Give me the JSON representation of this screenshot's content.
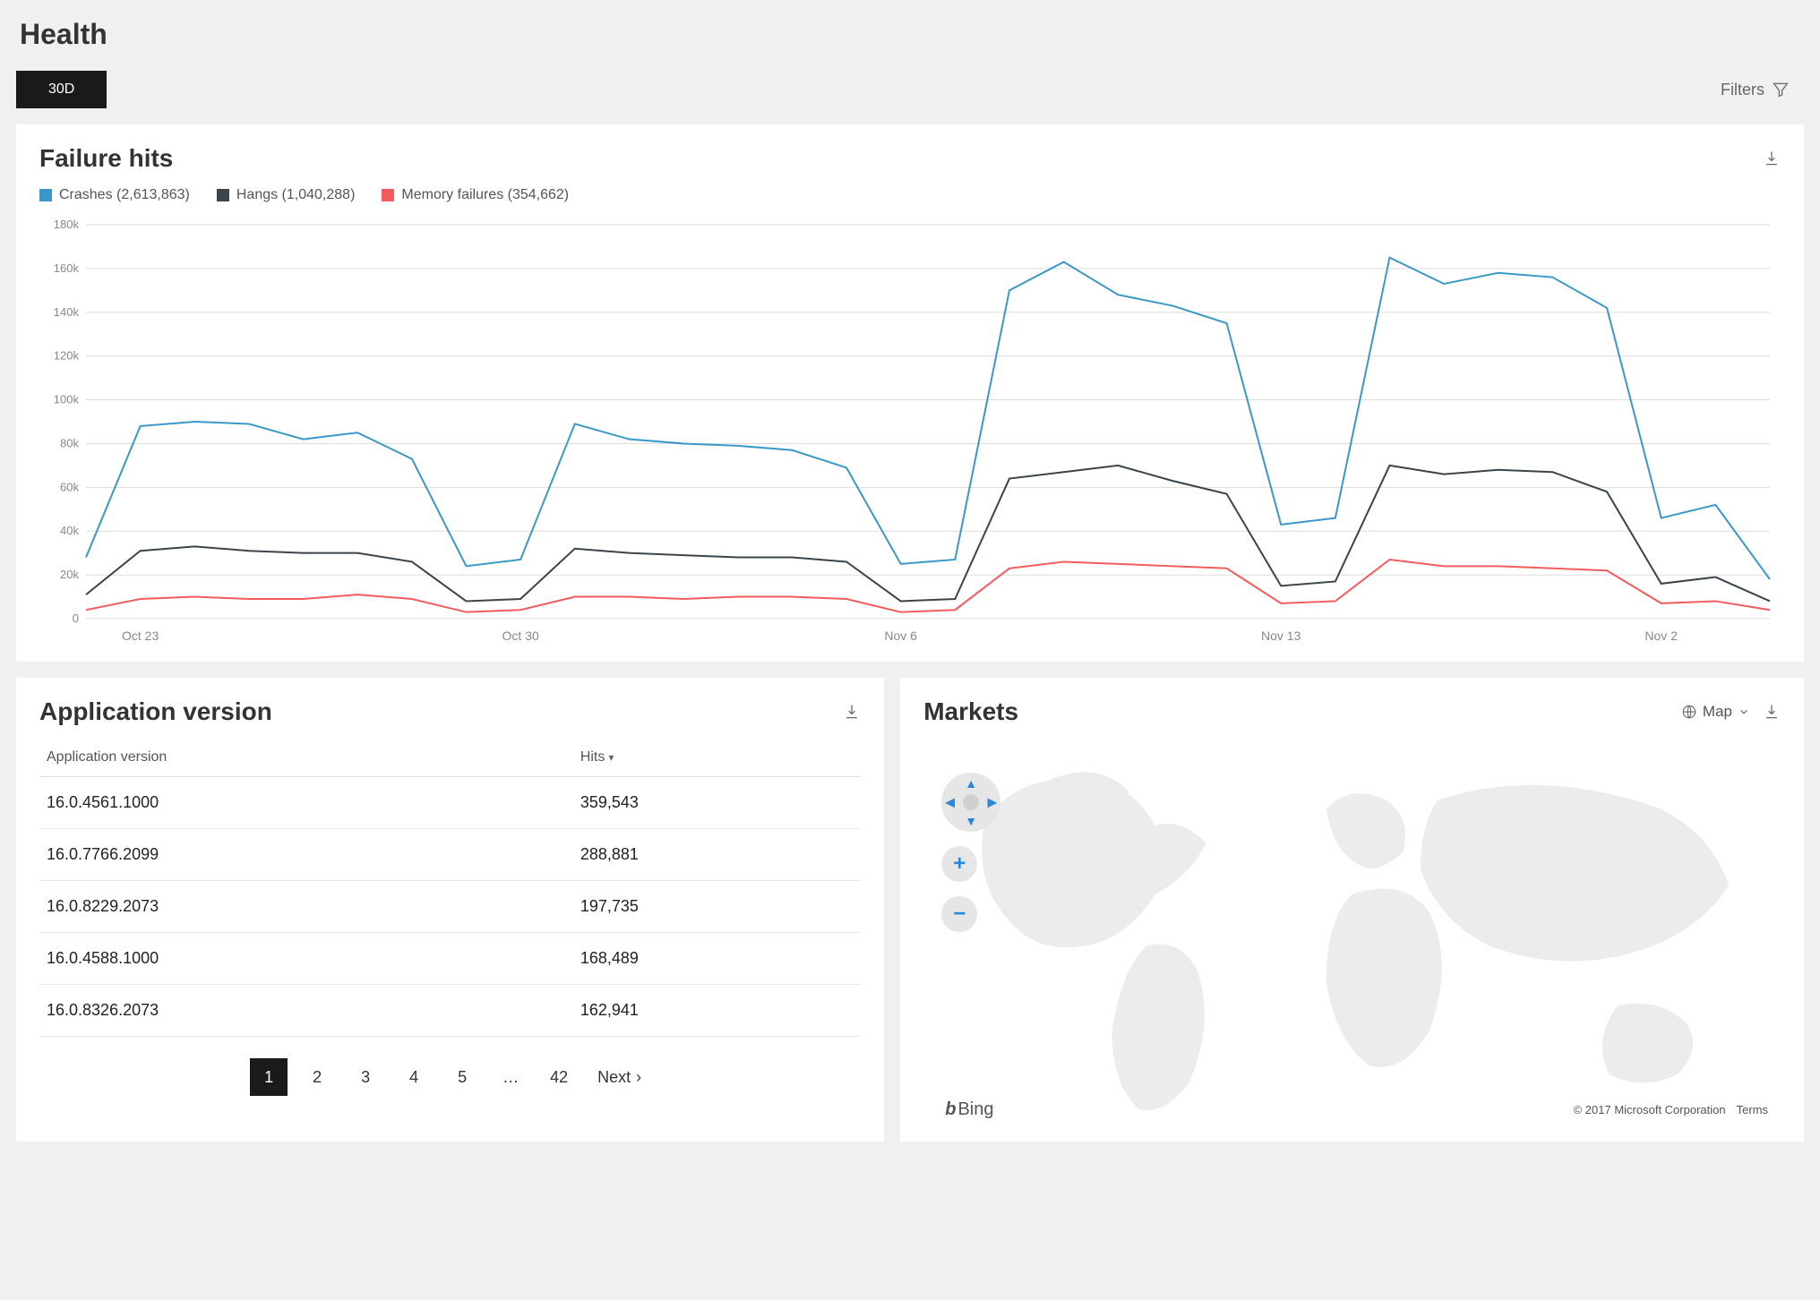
{
  "page": {
    "title": "Health",
    "range_button": "30D",
    "filters_label": "Filters"
  },
  "failure_hits": {
    "title": "Failure hits",
    "legend": [
      {
        "label": "Crashes (2,613,863)",
        "color": "#3a98c7"
      },
      {
        "label": "Hangs (1,040,288)",
        "color": "#3b444b"
      },
      {
        "label": "Memory failures (354,662)",
        "color": "#f25c5c"
      }
    ]
  },
  "chart_data": {
    "type": "line",
    "x": [
      "Oct 22",
      "Oct 23",
      "Oct 24",
      "Oct 25",
      "Oct 26",
      "Oct 27",
      "Oct 28",
      "Oct 29",
      "Oct 30",
      "Oct 31",
      "Nov 1",
      "Nov 2",
      "Nov 3",
      "Nov 4",
      "Nov 5",
      "Nov 6",
      "Nov 7",
      "Nov 8",
      "Nov 9",
      "Nov 10",
      "Nov 11",
      "Nov 12",
      "Nov 13",
      "Nov 14",
      "Nov 15",
      "Nov 16",
      "Nov 17",
      "Nov 18",
      "Nov 19",
      "Nov 20"
    ],
    "x_tick_labels": [
      "Oct 23",
      "Oct 30",
      "Nov 6",
      "Nov 13",
      "Nov 2"
    ],
    "x_tick_indices": [
      1,
      8,
      15,
      22,
      29
    ],
    "y_ticks": [
      0,
      20000,
      40000,
      60000,
      80000,
      100000,
      120000,
      140000,
      160000,
      180000
    ],
    "y_tick_labels": [
      "0",
      "20k",
      "40k",
      "60k",
      "80k",
      "100k",
      "120k",
      "140k",
      "160k",
      "180k"
    ],
    "ylim": [
      0,
      180000
    ],
    "series": [
      {
        "name": "Crashes",
        "color": "#3a98c7",
        "values": [
          28000,
          88000,
          90000,
          89000,
          82000,
          85000,
          73000,
          24000,
          27000,
          89000,
          82000,
          80000,
          79000,
          77000,
          69000,
          25000,
          27000,
          150000,
          163000,
          148000,
          143000,
          135000,
          43000,
          46000,
          165000,
          153000,
          158000,
          156000,
          142000,
          46000,
          52000,
          18000
        ]
      },
      {
        "name": "Hangs",
        "color": "#3b444b",
        "values": [
          11000,
          31000,
          33000,
          31000,
          30000,
          30000,
          26000,
          8000,
          9000,
          32000,
          30000,
          29000,
          28000,
          28000,
          26000,
          8000,
          9000,
          64000,
          67000,
          70000,
          63000,
          57000,
          15000,
          17000,
          70000,
          66000,
          68000,
          67000,
          58000,
          16000,
          19000,
          8000
        ]
      },
      {
        "name": "Memory failures",
        "color": "#f25c5c",
        "values": [
          4000,
          9000,
          10000,
          9000,
          9000,
          11000,
          9000,
          3000,
          4000,
          10000,
          10000,
          9000,
          10000,
          10000,
          9000,
          3000,
          4000,
          23000,
          26000,
          25000,
          24000,
          23000,
          7000,
          8000,
          27000,
          24000,
          24000,
          23000,
          22000,
          7000,
          8000,
          4000
        ]
      }
    ]
  },
  "app_version": {
    "title": "Application version",
    "col_version": "Application version",
    "col_hits": "Hits",
    "rows": [
      {
        "version": "16.0.4561.1000",
        "hits": "359,543"
      },
      {
        "version": "16.0.7766.2099",
        "hits": "288,881"
      },
      {
        "version": "16.0.8229.2073",
        "hits": "197,735"
      },
      {
        "version": "16.0.4588.1000",
        "hits": "168,489"
      },
      {
        "version": "16.0.8326.2073",
        "hits": "162,941"
      }
    ],
    "pages": [
      "1",
      "2",
      "3",
      "4",
      "5",
      "…",
      "42"
    ],
    "next_label": "Next"
  },
  "markets": {
    "title": "Markets",
    "map_toggle": "Map",
    "brand": "Bing",
    "copyright": "© 2017 Microsoft Corporation",
    "terms": "Terms"
  }
}
